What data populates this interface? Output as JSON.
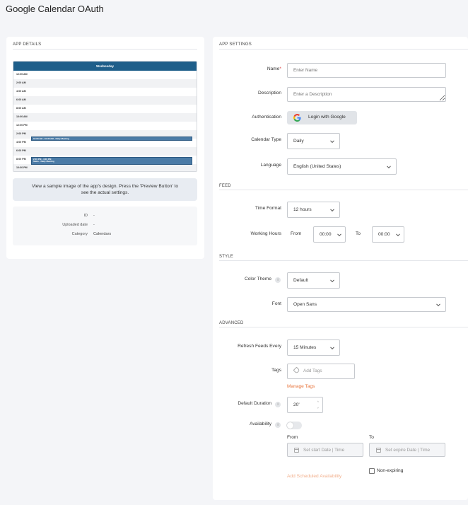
{
  "page": {
    "title": "Google Calendar OAuth"
  },
  "app_details": {
    "section_title": "APP DETAILS",
    "preview": {
      "day": "Wednesday",
      "times": [
        "12:00 AM",
        "2:00 AM",
        "4:00 AM",
        "6:00 AM",
        "8:00 AM",
        "10:00 AM",
        "12:00 PM",
        "2:00 PM",
        "4:00 PM",
        "6:00 PM",
        "8:00 PM",
        "10:00 PM"
      ],
      "event1": "10:00 AM - 10:30 AM - Daily Meeting",
      "event2_line1": "2:00 PM - 4:00 PM",
      "event2_line2": "Sales - Daily Meeting"
    },
    "info_line1": "View a sample image of the app's design. Press the 'Preview Button' to",
    "info_line2": "see the actual settings.",
    "meta": {
      "id_label": "ID",
      "id_value": "-",
      "uploaded_label": "Uploaded date",
      "uploaded_value": "-",
      "category_label": "Category",
      "category_value": "Calendars"
    }
  },
  "app_settings": {
    "section_title": "APP SETTINGS",
    "name_label": "Name",
    "name_required": "*",
    "name_placeholder": "Enter Name",
    "description_label": "Description",
    "description_placeholder": "Enter a Description",
    "authentication_label": "Authentication",
    "google_button": "Login with Google",
    "calendar_type_label": "Calendar Type",
    "calendar_type_value": "Daily",
    "language_label": "Language",
    "language_value": "English (United States)"
  },
  "feed": {
    "section_title": "FEED",
    "time_format_label": "Time Format",
    "time_format_value": "12 hours",
    "working_hours_label": "Working Hours",
    "from_label": "From",
    "from_value": "00:00",
    "to_label": "To",
    "to_value": "00:00"
  },
  "style": {
    "section_title": "STYLE",
    "color_theme_label": "Color Theme",
    "color_theme_value": "Default",
    "font_label": "Font",
    "font_value": "Open Sans"
  },
  "advanced": {
    "section_title": "ADVANCED",
    "refresh_label": "Refresh Feeds Every",
    "refresh_value": "15 Minutes",
    "tags_label": "Tags",
    "tags_placeholder": "Add Tags",
    "manage_tags": "Manage Tags",
    "default_duration_label": "Default Duration",
    "default_duration_value": "20'",
    "availability_label": "Availability",
    "avail_from_label": "From",
    "avail_to_label": "To",
    "start_placeholder": "Set start Date | Time",
    "expire_placeholder": "Set expire Date | Time",
    "non_expiring": "Non-expiring",
    "add_scheduled": "Add Scheduled Availability"
  },
  "icons": {
    "info": "i",
    "up_arrow": "˄",
    "down_arrow": "˅"
  },
  "colors": {
    "accent": "#e8743b",
    "preview_header": "#1e5e8a",
    "event": "#4b7ba6"
  }
}
